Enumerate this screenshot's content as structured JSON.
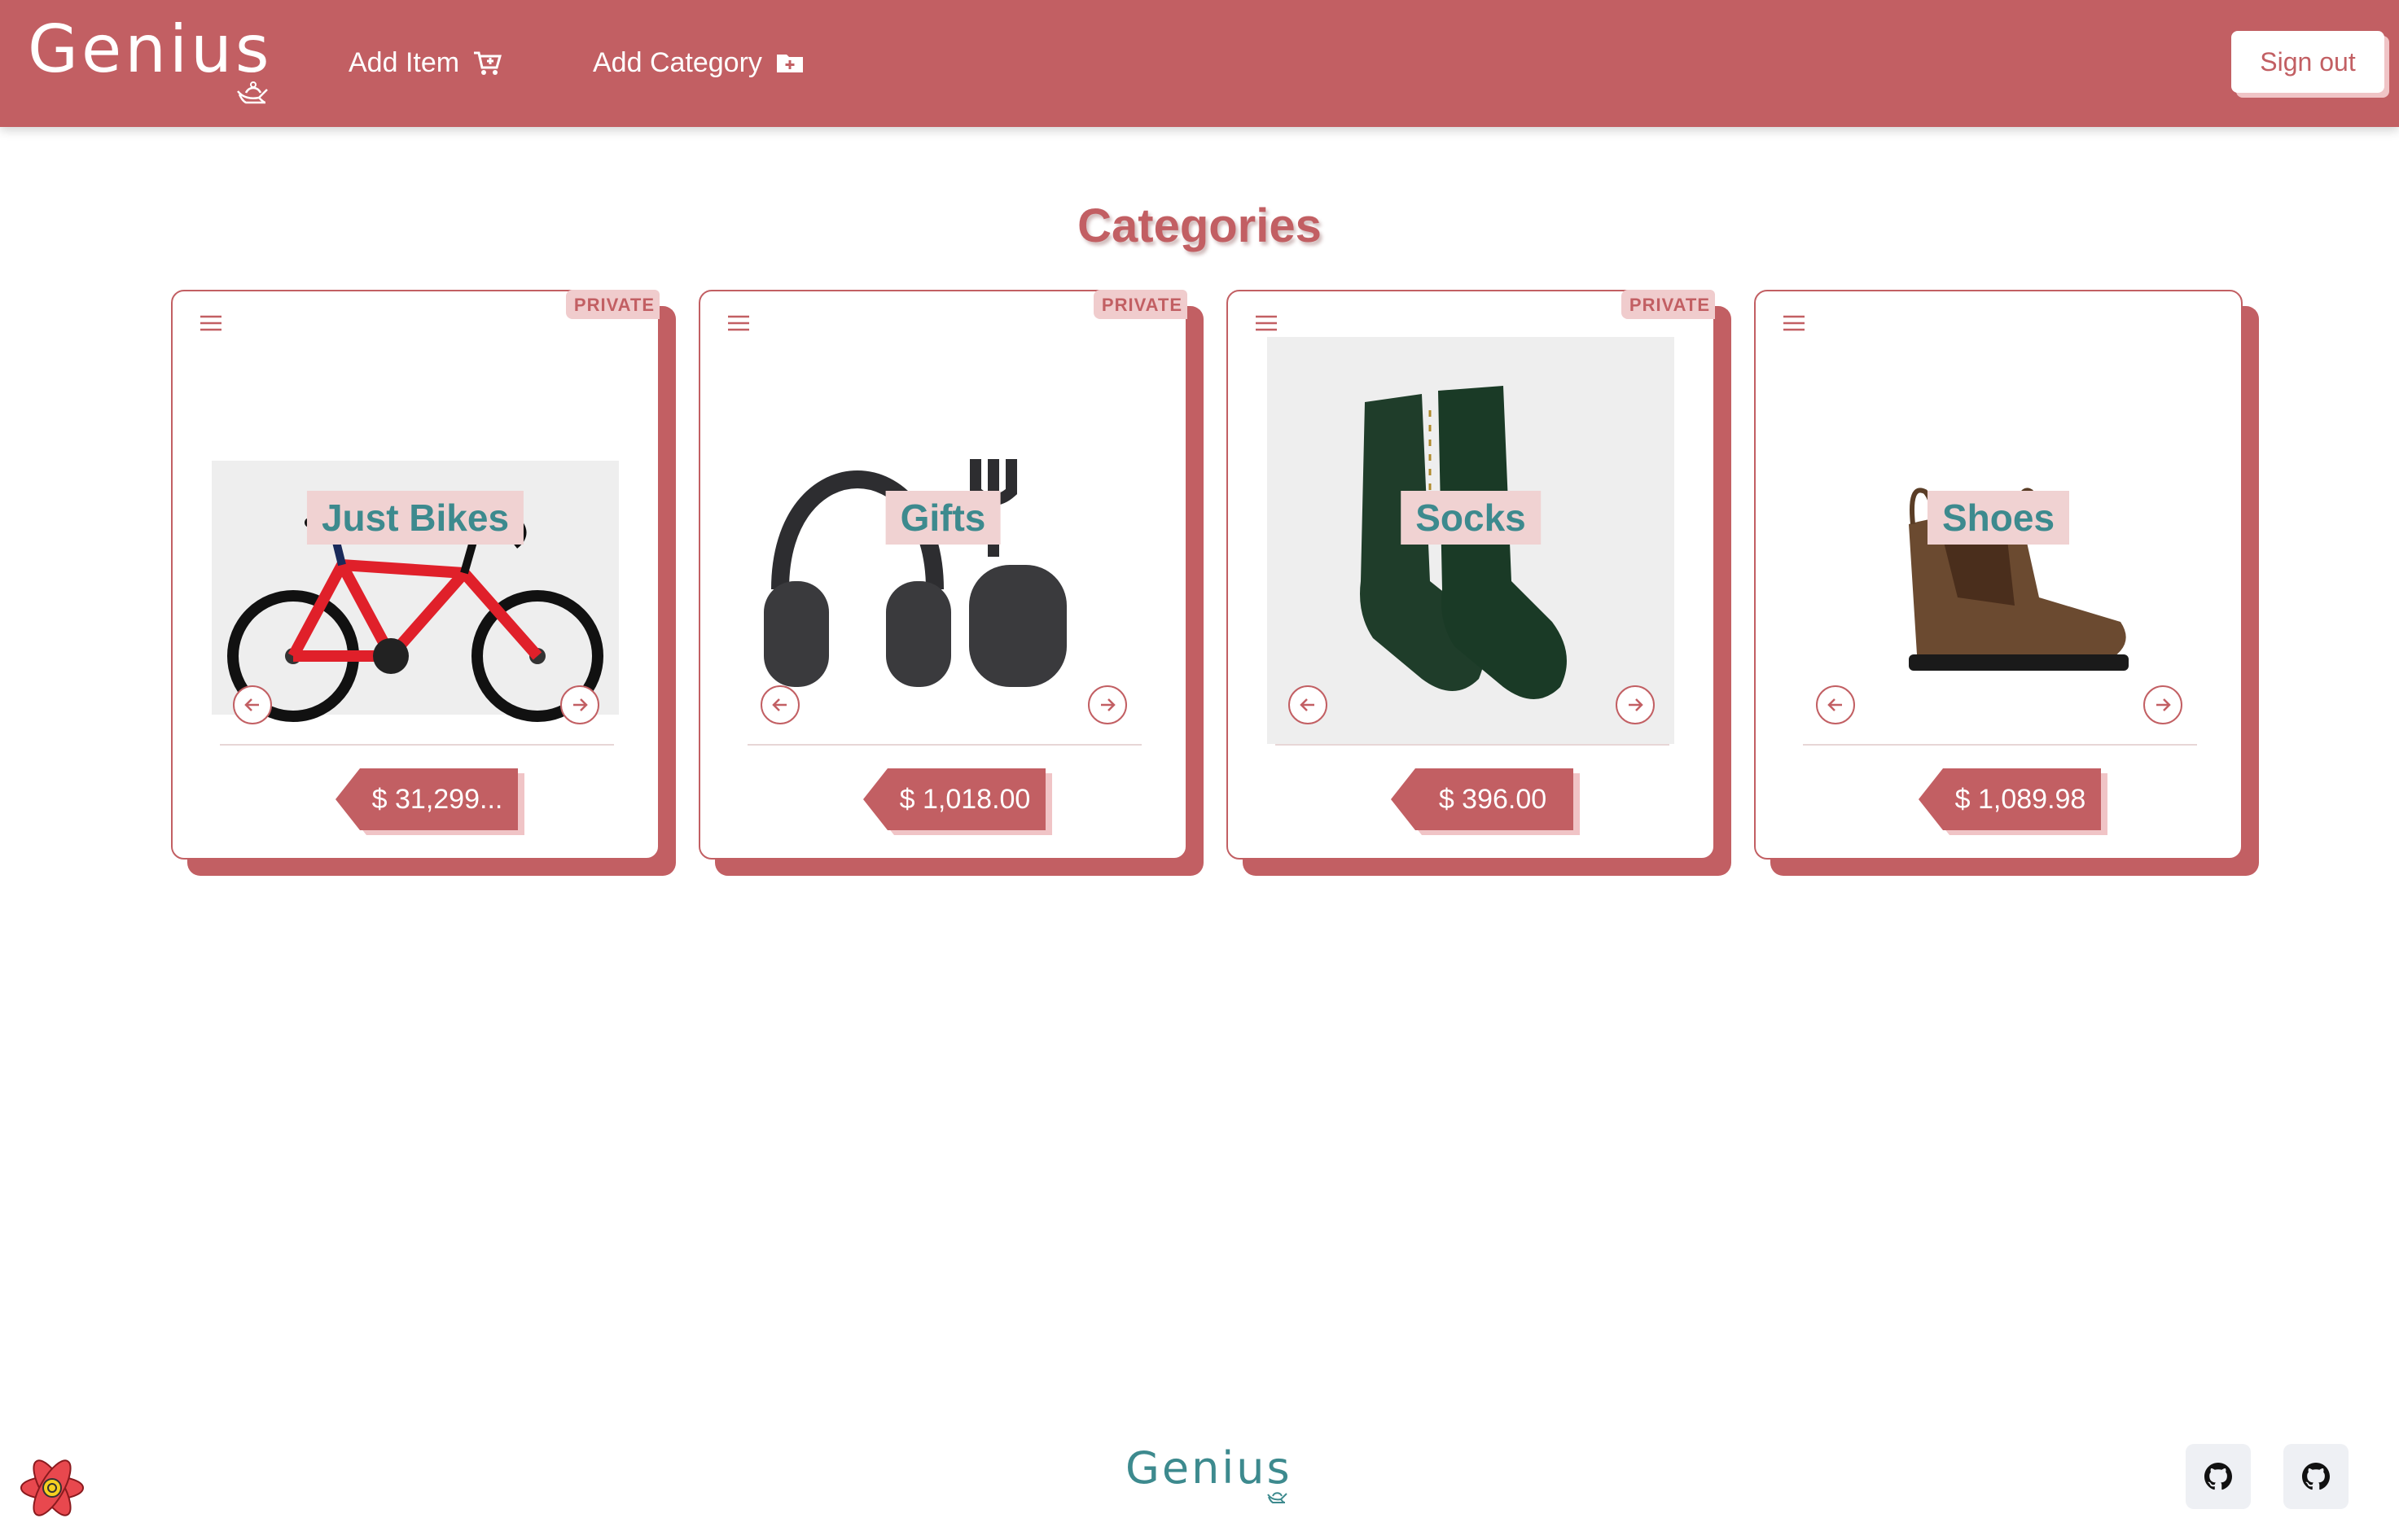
{
  "header": {
    "logo": "Genius",
    "nav": [
      {
        "label": "Add Item",
        "icon": "cart-plus-icon"
      },
      {
        "label": "Add Category",
        "icon": "folder-plus-icon"
      }
    ],
    "sign_out_label": "Sign out"
  },
  "main": {
    "title": "Categories",
    "cards": [
      {
        "name": "Just Bikes",
        "price": "$ 31,299...",
        "badge": "PRIVATE",
        "image": "road-bike"
      },
      {
        "name": "Gifts",
        "price": "$ 1,018.00",
        "badge": "PRIVATE",
        "image": "headphones"
      },
      {
        "name": "Socks",
        "price": "$ 396.00",
        "badge": "PRIVATE",
        "image": "green-socks"
      },
      {
        "name": "Shoes",
        "price": "$ 1,089.98",
        "badge": "",
        "image": "brown-chelsea-boot"
      }
    ]
  },
  "footer": {
    "logo": "Genius",
    "icons": [
      "react-icon",
      "github-icon",
      "github-icon"
    ]
  },
  "colors": {
    "brand": "#c25f63",
    "accent_teal": "#3d8a8e",
    "label_bg": "#f0d2d2"
  }
}
